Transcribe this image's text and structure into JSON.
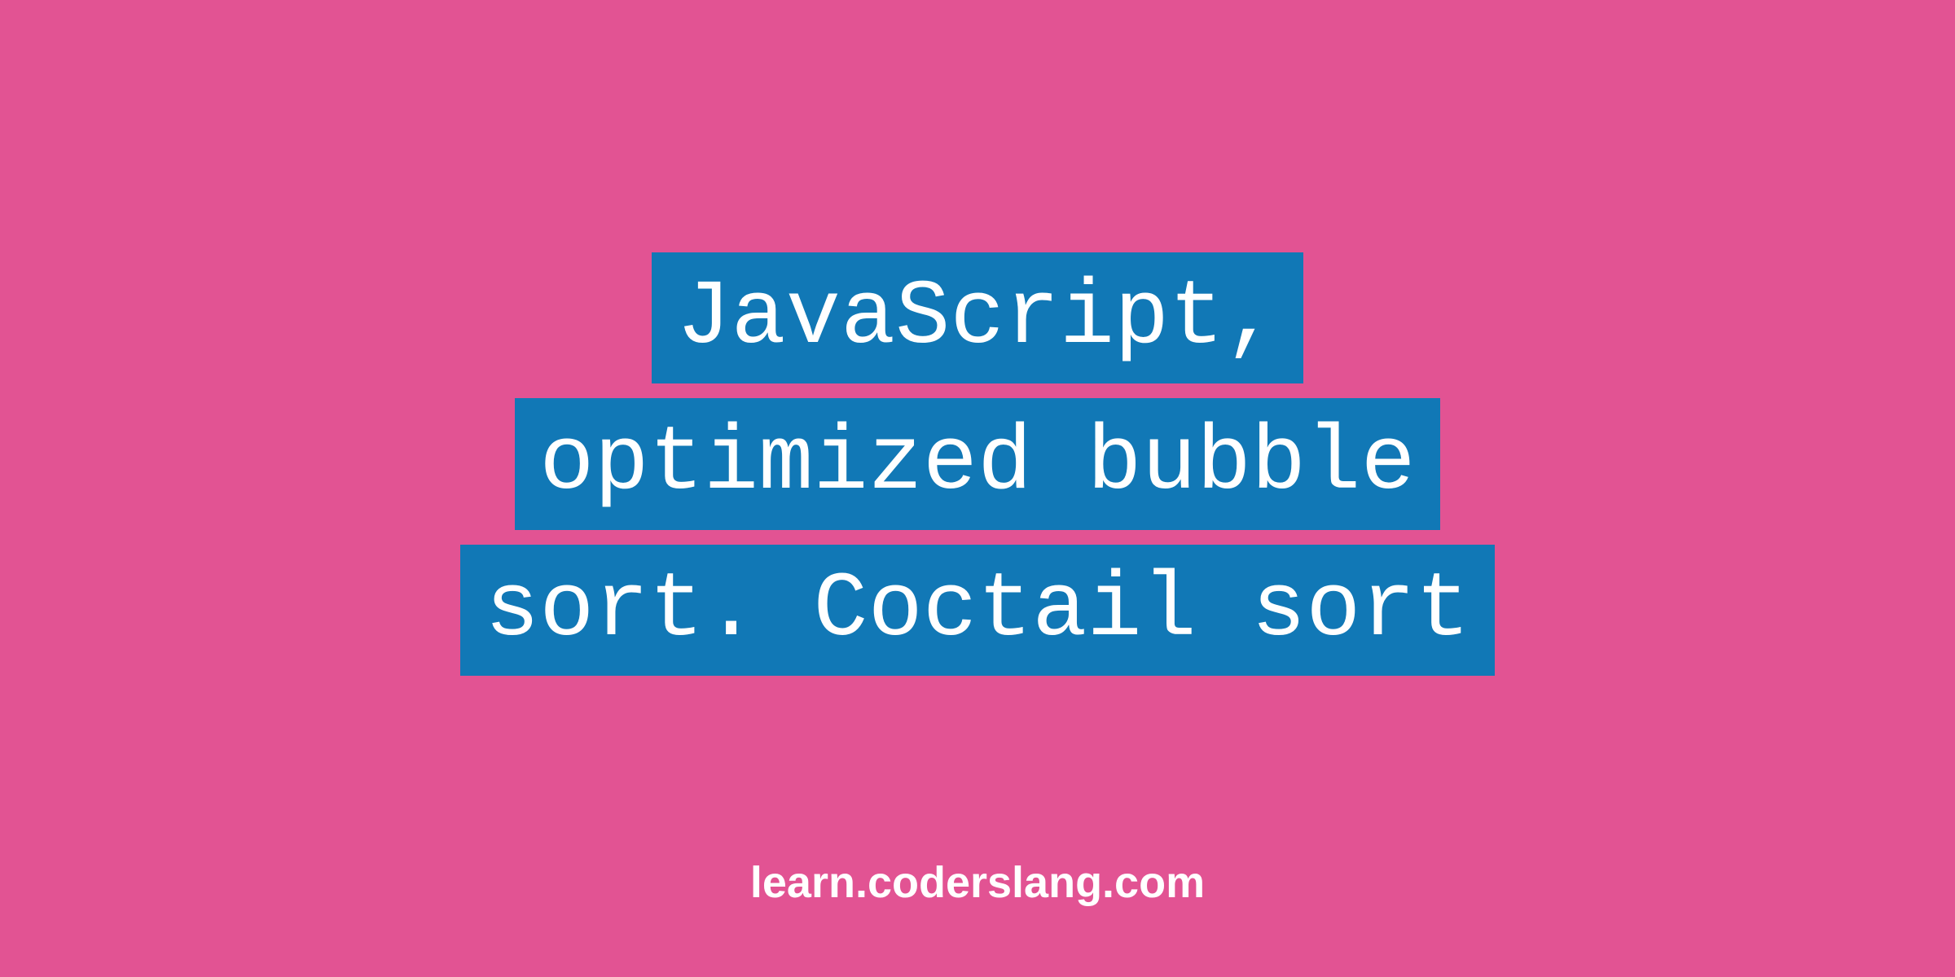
{
  "title": {
    "line1": "JavaScript,",
    "line2": "optimized bubble",
    "line3": "sort. Coctail sort"
  },
  "footer": "learn.coderslang.com",
  "colors": {
    "background": "#e25393",
    "highlight": "#1178b6",
    "text": "#ffffff"
  }
}
